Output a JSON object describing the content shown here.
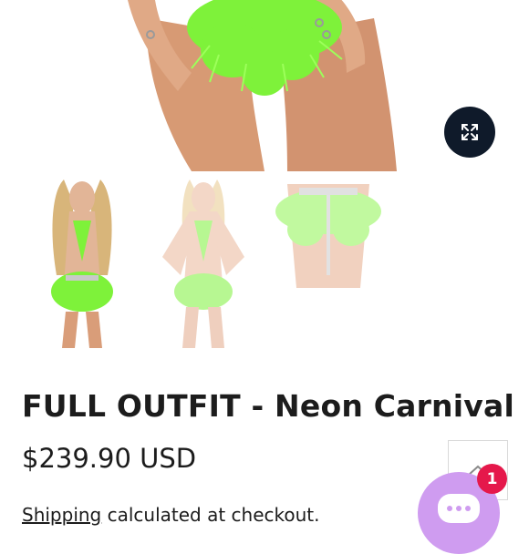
{
  "product": {
    "title": "FULL OUTFIT - Neon Carnival",
    "price": "$239.90 USD",
    "shipping_link": "Shipping",
    "shipping_rest": " calculated at checkout."
  },
  "gallery": {
    "thumbnails": [
      {
        "name": "full-outfit-front"
      },
      {
        "name": "full-outfit-posed"
      },
      {
        "name": "bottoms-detail"
      }
    ]
  },
  "chat": {
    "badge_count": "1"
  },
  "colors": {
    "neon_green": "#7ef23a",
    "skin": "#d9a07c",
    "zoom_button": "#0f1a2a",
    "chat_button": "#cf9cf0",
    "badge": "#e5184b"
  },
  "icons": [
    "expand-icon",
    "chevron-up-icon",
    "chat-dots-icon"
  ]
}
